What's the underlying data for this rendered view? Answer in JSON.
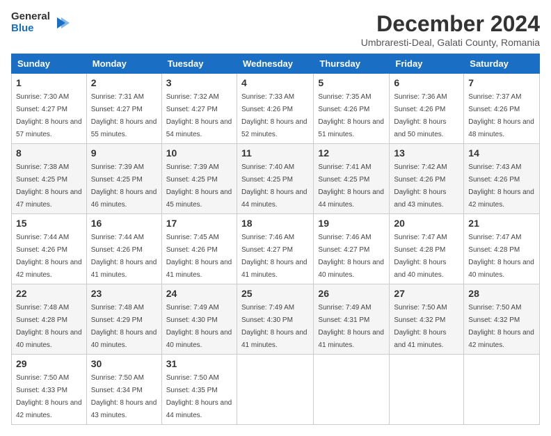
{
  "logo": {
    "line1": "General",
    "line2": "Blue"
  },
  "title": "December 2024",
  "location": "Umbraresti-Deal, Galati County, Romania",
  "days_header": [
    "Sunday",
    "Monday",
    "Tuesday",
    "Wednesday",
    "Thursday",
    "Friday",
    "Saturday"
  ],
  "weeks": [
    [
      {
        "day": "1",
        "sunrise": "7:30 AM",
        "sunset": "4:27 PM",
        "daylight": "8 hours and 57 minutes."
      },
      {
        "day": "2",
        "sunrise": "7:31 AM",
        "sunset": "4:27 PM",
        "daylight": "8 hours and 55 minutes."
      },
      {
        "day": "3",
        "sunrise": "7:32 AM",
        "sunset": "4:27 PM",
        "daylight": "8 hours and 54 minutes."
      },
      {
        "day": "4",
        "sunrise": "7:33 AM",
        "sunset": "4:26 PM",
        "daylight": "8 hours and 52 minutes."
      },
      {
        "day": "5",
        "sunrise": "7:35 AM",
        "sunset": "4:26 PM",
        "daylight": "8 hours and 51 minutes."
      },
      {
        "day": "6",
        "sunrise": "7:36 AM",
        "sunset": "4:26 PM",
        "daylight": "8 hours and 50 minutes."
      },
      {
        "day": "7",
        "sunrise": "7:37 AM",
        "sunset": "4:26 PM",
        "daylight": "8 hours and 48 minutes."
      }
    ],
    [
      {
        "day": "8",
        "sunrise": "7:38 AM",
        "sunset": "4:25 PM",
        "daylight": "8 hours and 47 minutes."
      },
      {
        "day": "9",
        "sunrise": "7:39 AM",
        "sunset": "4:25 PM",
        "daylight": "8 hours and 46 minutes."
      },
      {
        "day": "10",
        "sunrise": "7:39 AM",
        "sunset": "4:25 PM",
        "daylight": "8 hours and 45 minutes."
      },
      {
        "day": "11",
        "sunrise": "7:40 AM",
        "sunset": "4:25 PM",
        "daylight": "8 hours and 44 minutes."
      },
      {
        "day": "12",
        "sunrise": "7:41 AM",
        "sunset": "4:25 PM",
        "daylight": "8 hours and 44 minutes."
      },
      {
        "day": "13",
        "sunrise": "7:42 AM",
        "sunset": "4:26 PM",
        "daylight": "8 hours and 43 minutes."
      },
      {
        "day": "14",
        "sunrise": "7:43 AM",
        "sunset": "4:26 PM",
        "daylight": "8 hours and 42 minutes."
      }
    ],
    [
      {
        "day": "15",
        "sunrise": "7:44 AM",
        "sunset": "4:26 PM",
        "daylight": "8 hours and 42 minutes."
      },
      {
        "day": "16",
        "sunrise": "7:44 AM",
        "sunset": "4:26 PM",
        "daylight": "8 hours and 41 minutes."
      },
      {
        "day": "17",
        "sunrise": "7:45 AM",
        "sunset": "4:26 PM",
        "daylight": "8 hours and 41 minutes."
      },
      {
        "day": "18",
        "sunrise": "7:46 AM",
        "sunset": "4:27 PM",
        "daylight": "8 hours and 41 minutes."
      },
      {
        "day": "19",
        "sunrise": "7:46 AM",
        "sunset": "4:27 PM",
        "daylight": "8 hours and 40 minutes."
      },
      {
        "day": "20",
        "sunrise": "7:47 AM",
        "sunset": "4:28 PM",
        "daylight": "8 hours and 40 minutes."
      },
      {
        "day": "21",
        "sunrise": "7:47 AM",
        "sunset": "4:28 PM",
        "daylight": "8 hours and 40 minutes."
      }
    ],
    [
      {
        "day": "22",
        "sunrise": "7:48 AM",
        "sunset": "4:28 PM",
        "daylight": "8 hours and 40 minutes."
      },
      {
        "day": "23",
        "sunrise": "7:48 AM",
        "sunset": "4:29 PM",
        "daylight": "8 hours and 40 minutes."
      },
      {
        "day": "24",
        "sunrise": "7:49 AM",
        "sunset": "4:30 PM",
        "daylight": "8 hours and 40 minutes."
      },
      {
        "day": "25",
        "sunrise": "7:49 AM",
        "sunset": "4:30 PM",
        "daylight": "8 hours and 41 minutes."
      },
      {
        "day": "26",
        "sunrise": "7:49 AM",
        "sunset": "4:31 PM",
        "daylight": "8 hours and 41 minutes."
      },
      {
        "day": "27",
        "sunrise": "7:50 AM",
        "sunset": "4:32 PM",
        "daylight": "8 hours and 41 minutes."
      },
      {
        "day": "28",
        "sunrise": "7:50 AM",
        "sunset": "4:32 PM",
        "daylight": "8 hours and 42 minutes."
      }
    ],
    [
      {
        "day": "29",
        "sunrise": "7:50 AM",
        "sunset": "4:33 PM",
        "daylight": "8 hours and 42 minutes."
      },
      {
        "day": "30",
        "sunrise": "7:50 AM",
        "sunset": "4:34 PM",
        "daylight": "8 hours and 43 minutes."
      },
      {
        "day": "31",
        "sunrise": "7:50 AM",
        "sunset": "4:35 PM",
        "daylight": "8 hours and 44 minutes."
      },
      null,
      null,
      null,
      null
    ]
  ],
  "labels": {
    "sunrise": "Sunrise:",
    "sunset": "Sunset:",
    "daylight": "Daylight:"
  }
}
